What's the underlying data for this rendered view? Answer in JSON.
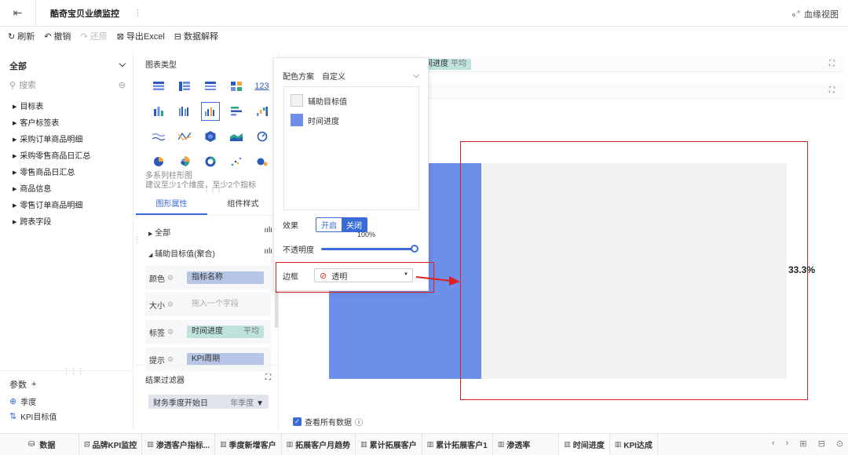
{
  "header": {
    "title": "酷奇宝贝业绩监控",
    "more": "⋮",
    "lineage": "血缘视图"
  },
  "toolbar": {
    "refresh": "刷新",
    "undo": "撤销",
    "redo": "还原",
    "export": "导出Excel",
    "explain": "数据解释"
  },
  "left": {
    "scope": "全部",
    "search_placeholder": "搜索",
    "fields": [
      "目标表",
      "客户标签表",
      "采购订单商品明细",
      "采购零售商品日汇总",
      "零售商品日汇总",
      "商品信息",
      "零售订单商品明细",
      "跨表字段"
    ],
    "params_label": "参数",
    "params": [
      "季度",
      "KPI目标值"
    ]
  },
  "chart_type": {
    "heading": "图表类型",
    "desc1": "多系列柱形图",
    "desc2": "建议至少1个维度，至少2个指标",
    "tab_properties": "图形属性",
    "tab_style": "组件样式",
    "row_all": "全部",
    "row_aux": "辅助目标值(聚合)",
    "color_label": "颜色",
    "color_value": "指标名称",
    "size_label": "大小",
    "size_placeholder": "拖入一个字段",
    "label_label": "标签",
    "label_value": "时间进度",
    "label_agg": "平均",
    "tip_label": "提示",
    "tip_value": "KPI周期",
    "filter_title": "结果过滤器",
    "filter_field": "财务季度开始日",
    "filter_agg": "年季度"
  },
  "canvas": {
    "shelf_pill": "间进度",
    "shelf_pill_agg": "平均",
    "percent_label": "33.3%",
    "view_all": "查看所有数据"
  },
  "chart_data": {
    "type": "bar",
    "categories": [
      ""
    ],
    "series": [
      {
        "name": "时间进度",
        "values": [
          33.3
        ]
      },
      {
        "name": "辅助目标值",
        "values": [
          100
        ]
      }
    ],
    "ylim": [
      0,
      100
    ],
    "data_labels": [
      "33.3%"
    ]
  },
  "popup": {
    "scheme_label": "配色方案",
    "scheme_value": "自定义",
    "colors": [
      {
        "name": "辅助目标值",
        "color": "#f2f2f2"
      },
      {
        "name": "时间进度",
        "color": "#6d8ee9"
      }
    ],
    "effect_label": "效果",
    "effect_on": "开启",
    "effect_off": "关闭",
    "opacity_value": "100%",
    "opacity_label": "不透明度",
    "opacity_fraction": 1.0,
    "border_label": "边框",
    "border_value": "透明"
  },
  "bottom": {
    "data_label": "数据",
    "tabs": [
      "品牌KPI监控",
      "渗透客户指标...",
      "季度新增客户",
      "拓展客户月趋势",
      "累计拓展客户",
      "累计拓展客户1",
      "渗透率",
      "时间进度",
      "KPI达成"
    ],
    "active_tab": "时间进度"
  },
  "colors": {
    "accent": "#3a6bd6",
    "bar_series": "#6d8ee9",
    "highlight": "#e02020"
  }
}
